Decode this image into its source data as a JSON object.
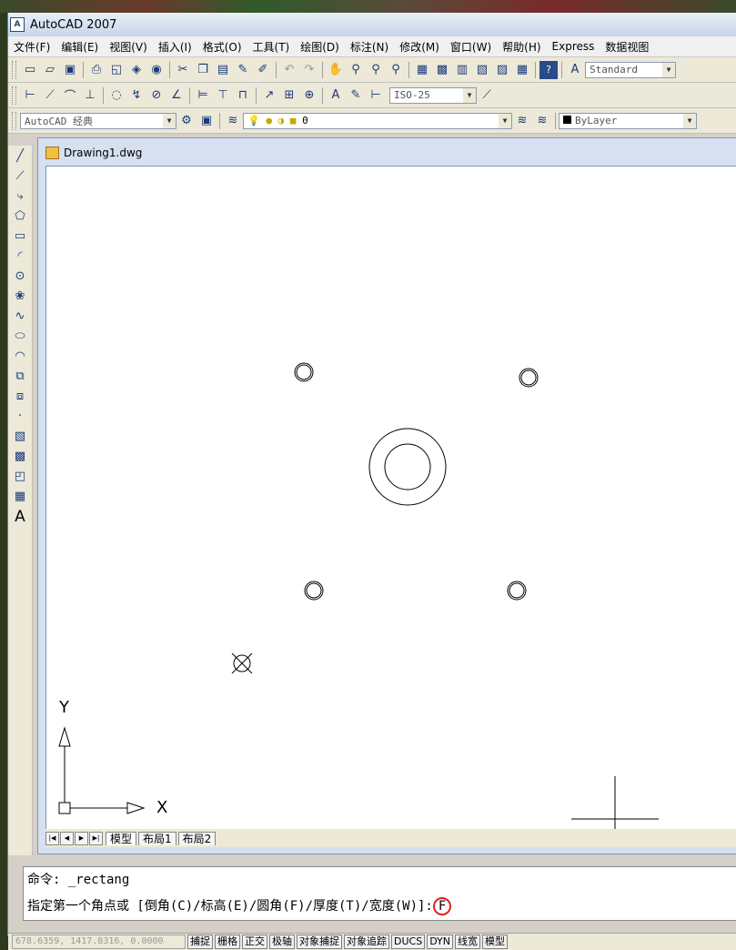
{
  "window": {
    "title": "AutoCAD 2007",
    "icon_label": "A"
  },
  "menu": [
    "文件(F)",
    "编辑(E)",
    "视图(V)",
    "插入(I)",
    "格式(O)",
    "工具(T)",
    "绘图(D)",
    "标注(N)",
    "修改(M)",
    "窗口(W)",
    "帮助(H)",
    "Express",
    "数据视图"
  ],
  "toolbar": {
    "text_style": "Standard",
    "dim_style": "ISO-25",
    "workspace": "AutoCAD 经典",
    "layer": "0",
    "linetype": "ByLayer"
  },
  "document": {
    "title": "Drawing1.dwg"
  },
  "ucs": {
    "x_label": "X",
    "y_label": "Y"
  },
  "layout_tabs": [
    "模型",
    "布局1",
    "布局2"
  ],
  "command": {
    "line1": "命令: _rectang",
    "line2_prefix": "指定第一个角点或 [倒角(C)/标高(E)/圆角(F)/厚度(T)/宽度(W)]:",
    "line2_input": "F"
  },
  "status": {
    "coords": "678.6359, 1417.8316, 0.0000",
    "buttons": [
      "捕捉",
      "栅格",
      "正交",
      "极轴",
      "对象捕捉",
      "对象追踪",
      "DUCS",
      "DYN",
      "线宽",
      "模型"
    ]
  },
  "colors": {
    "highlight": "#e02020",
    "canvas": "#ffffff"
  }
}
